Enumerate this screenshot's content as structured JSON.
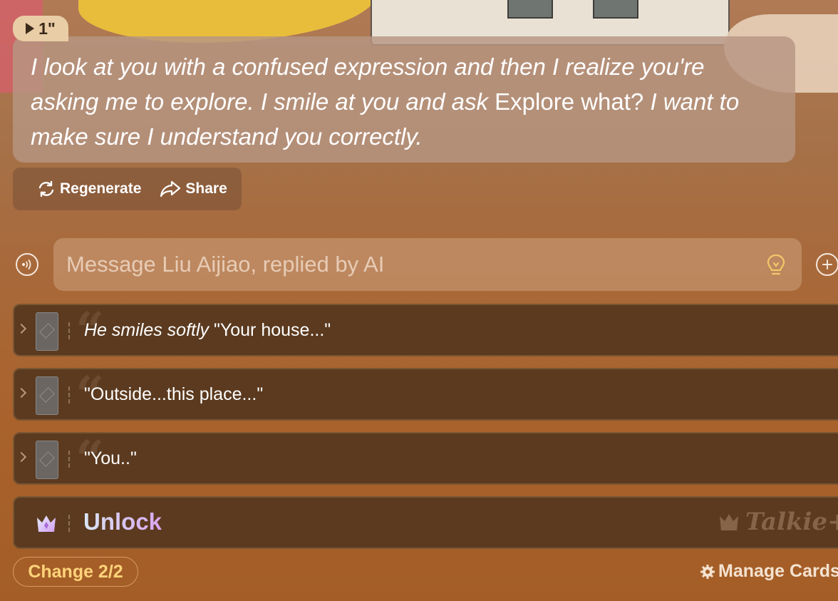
{
  "message": {
    "duration": "1\"",
    "parts": {
      "p1": "I look at you with a confused expression and then I realize you're asking me to explore. I smile at you and ask ",
      "p2": "Explore what?",
      "p3": " I want to make sure I understand you correctly."
    }
  },
  "actions": {
    "regenerate_label": "Regenerate",
    "share_label": "Share"
  },
  "composer": {
    "placeholder": "Message Liu Aijiao, replied by AI"
  },
  "suggestions": [
    {
      "italic": "He smiles softly",
      "text": " \"Your house...\""
    },
    {
      "italic": "",
      "text": "\"Outside...this place...\""
    },
    {
      "italic": "",
      "text": "\"You..\""
    }
  ],
  "unlock": {
    "label": "Unlock",
    "brand": "Talkie+"
  },
  "footer": {
    "change_label": "Change 2/2",
    "manage_label": "Manage Cards"
  },
  "icons": [
    "play-icon",
    "regenerate-icon",
    "share-icon",
    "voice-icon",
    "lightbulb-icon",
    "plus-icon",
    "card-icon",
    "crown-icon",
    "gear-icon"
  ]
}
